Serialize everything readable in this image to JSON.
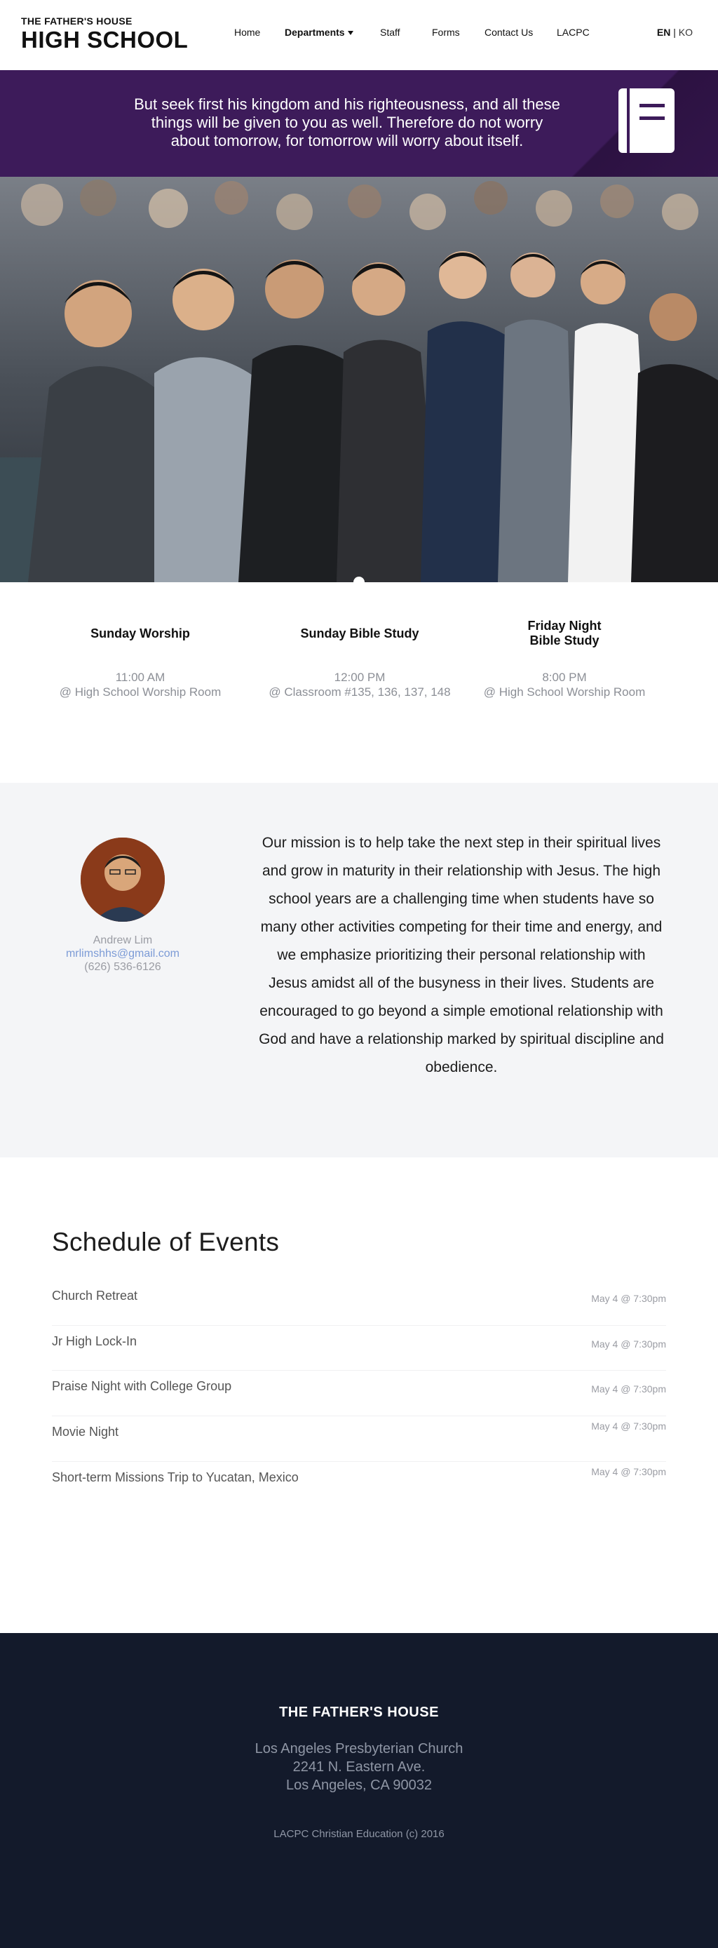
{
  "header": {
    "logo_small": "THE FATHER'S HOUSE",
    "logo_big": "HIGH SCHOOL",
    "nav": {
      "home": "Home",
      "departments": "Departments",
      "staff": "Staff",
      "forms": "Forms",
      "contact": "Contact Us",
      "lacpc": "LACPC"
    },
    "lang": {
      "en": "EN",
      "separator": "|",
      "ko": "KO"
    }
  },
  "banner": {
    "verse": "But seek first his kingdom and his righteousness, and all these things will be given to you as well.  Therefore do not worry about tomorrow, for tomorrow will worry about itself.",
    "background_color": "#3d1b5a",
    "icon": "book-icon"
  },
  "services": [
    {
      "title": "Sunday Worship",
      "time": "11:00 AM",
      "location": "@ High School Worship Room"
    },
    {
      "title": "Sunday Bible Study",
      "time": "12:00 PM",
      "location": "@ Classroom #135, 136, 137, 148"
    },
    {
      "title": "Friday Night Bible Study",
      "time": "8:00 PM",
      "location": "@ High School Worship Room"
    }
  ],
  "mission": {
    "staff_name": "Andrew Lim",
    "staff_email": "mrlimshhs@gmail.com",
    "staff_phone": "(626) 536-6126",
    "text": "Our mission is to help take the next step in their spiritual lives and grow in maturity in their relationship with Jesus. The high school years are a challenging time when students have so many other activities competing for their time and energy, and we emphasize prioritizing their personal relationship with Jesus amidst all of the busyness in their lives. Students are encouraged to go beyond a simple emotional relationship with God and have a relationship marked by spiritual discipline and obedience."
  },
  "schedule": {
    "title": "Schedule of Events",
    "events": [
      {
        "name": "Church Retreat",
        "date": "May 4 @ 7:30pm"
      },
      {
        "name": "Jr High Lock-In",
        "date": "May 4 @ 7:30pm"
      },
      {
        "name": "Praise Night with College Group",
        "date": "May 4 @ 7:30pm"
      },
      {
        "name": "Movie Night",
        "date": "May 4 @ 7:30pm"
      },
      {
        "name": "Short-term Missions Trip to Yucatan, Mexico",
        "date": "May 4 @ 7:30pm"
      }
    ]
  },
  "footer": {
    "title": "THE FATHER'S HOUSE",
    "address_line1": "Los Angeles Presbyterian Church",
    "address_line2": "2241 N. Eastern Ave.",
    "address_line3": "Los Angeles, CA 90032",
    "copyright": "LACPC Christian Education (c) 2016",
    "background_color": "#131a2b"
  }
}
